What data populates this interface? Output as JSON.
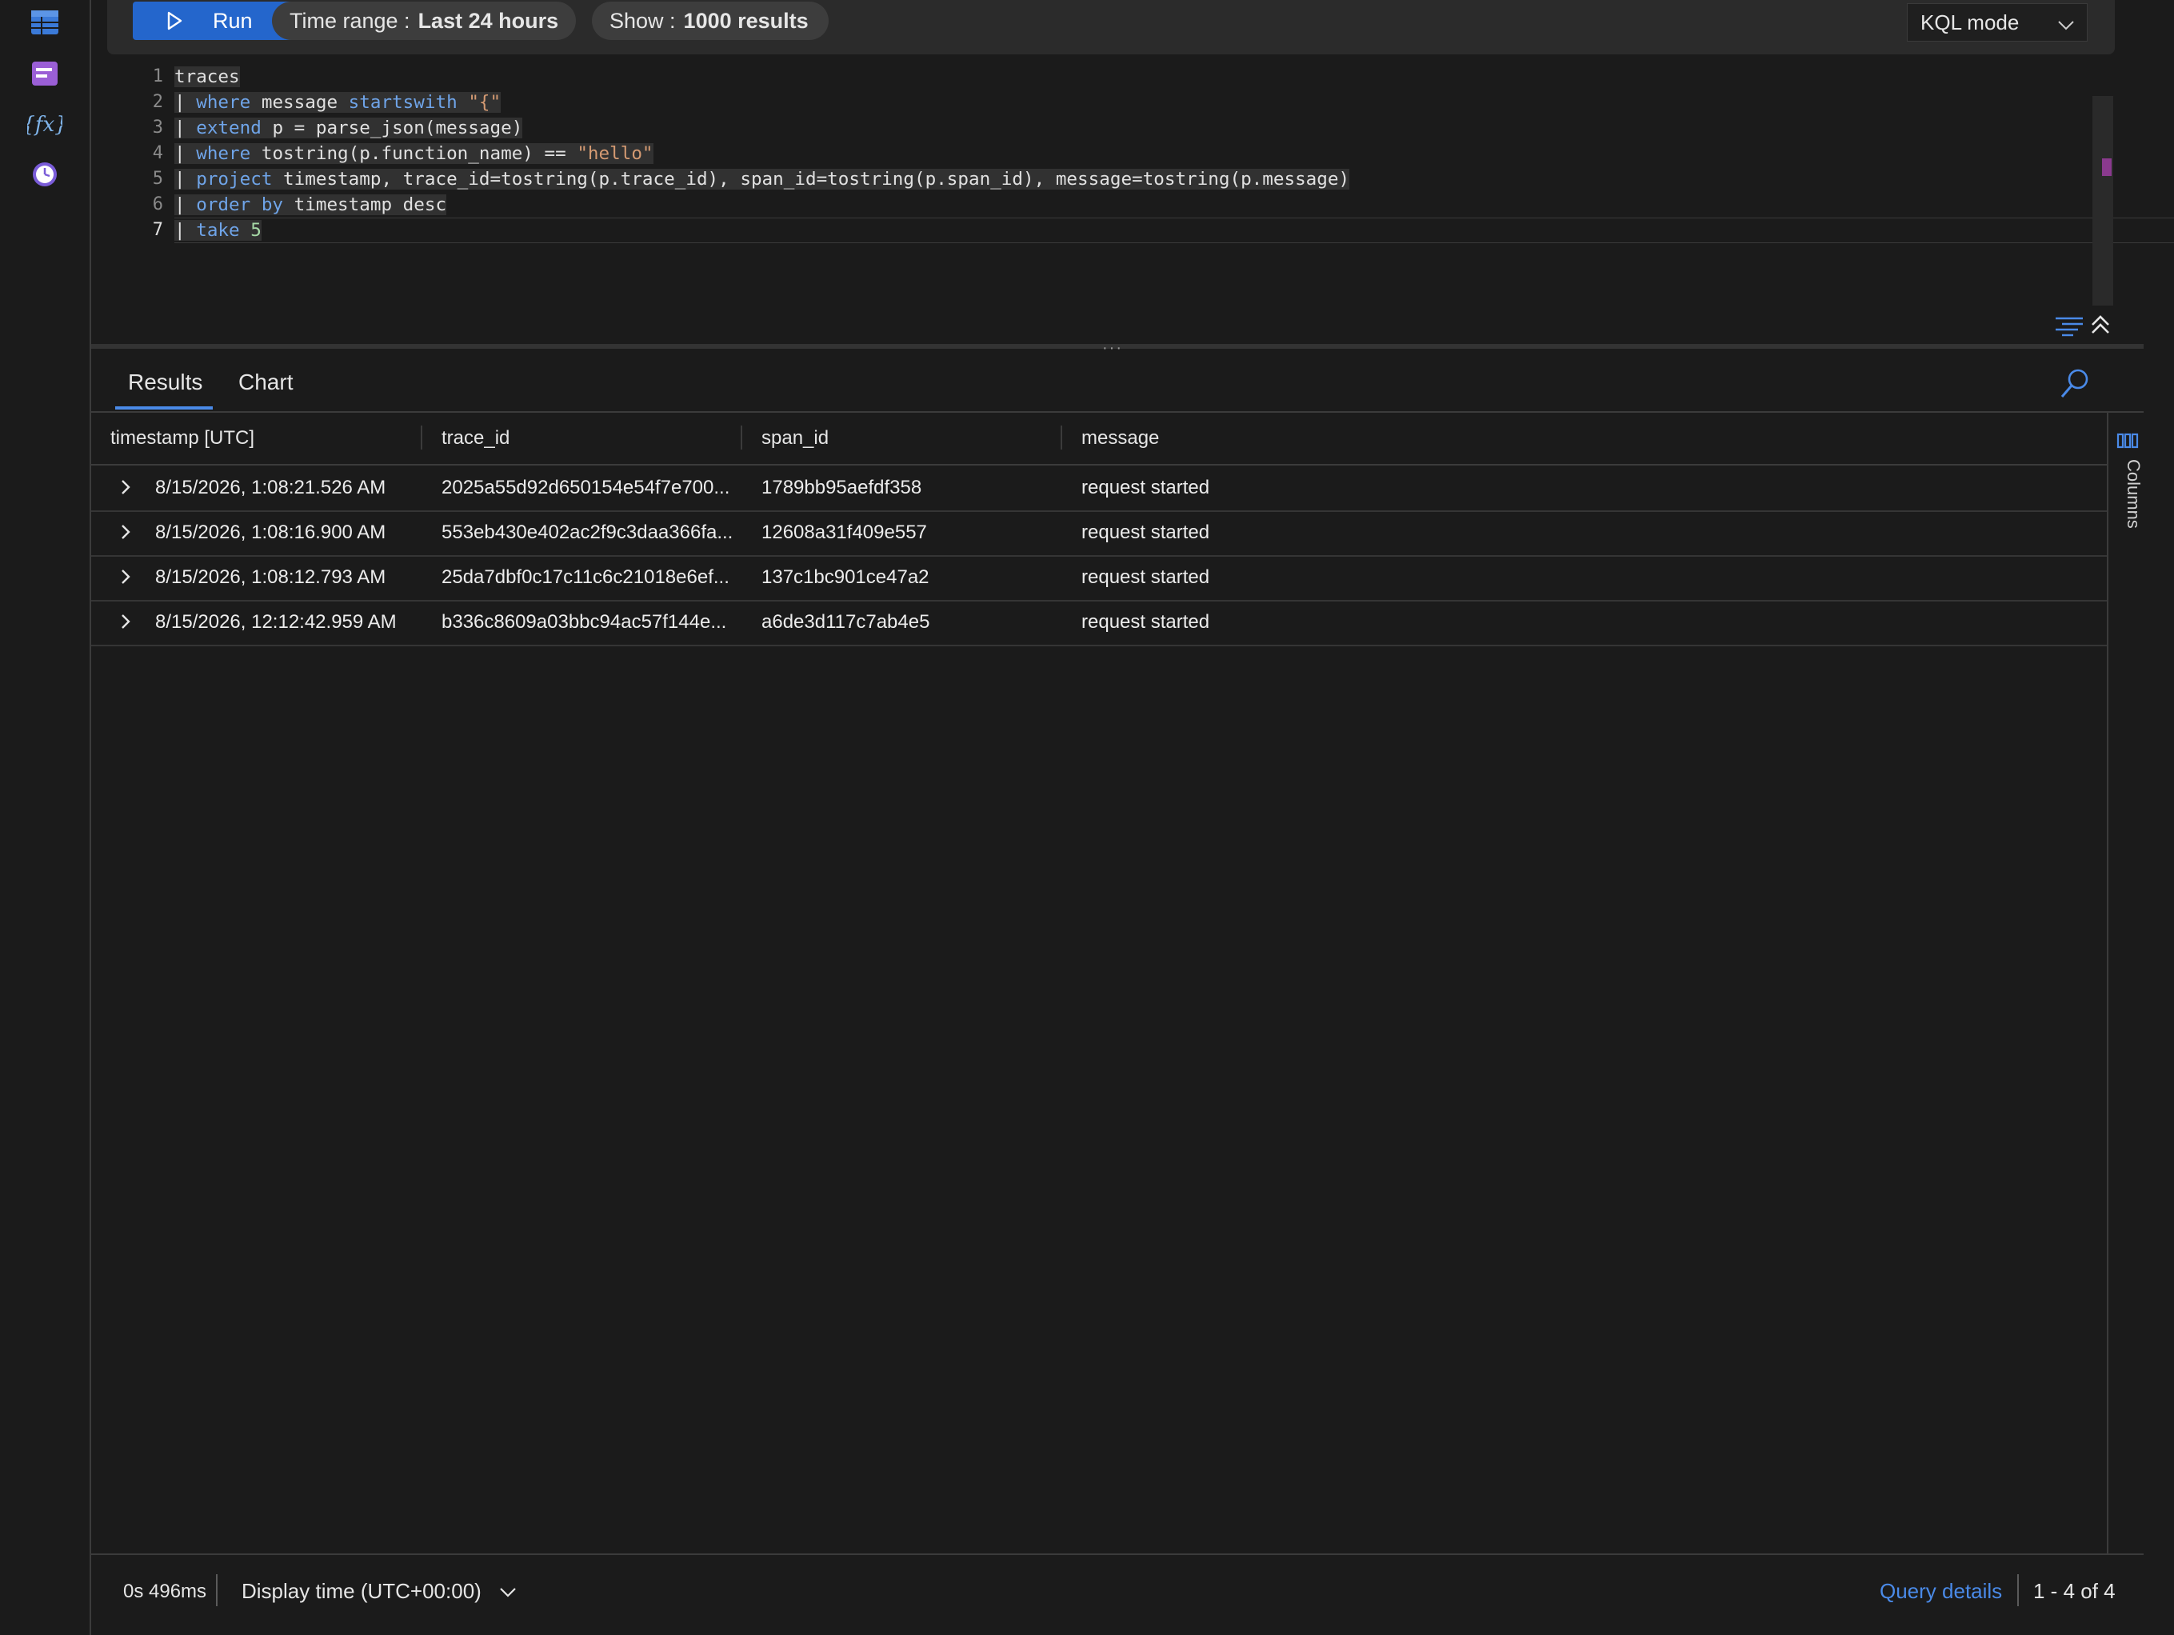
{
  "toolbar": {
    "run_label": "Run",
    "time_range_label": "Time range :",
    "time_range_value": "Last 24 hours",
    "show_label": "Show :",
    "show_value": "1000 results",
    "mode_label": "KQL mode"
  },
  "editor": {
    "line_numbers": [
      "1",
      "2",
      "3",
      "4",
      "5",
      "6",
      "7"
    ],
    "lines": {
      "l1": "traces",
      "l2a": "| ",
      "l2kw": "where",
      "l2b": " message ",
      "l2kw2": "startswith",
      "l2c": " ",
      "l2str": "\"{\"",
      "l3a": "| ",
      "l3kw": "extend",
      "l3b": " p = parse_json(message)",
      "l4a": "| ",
      "l4kw": "where",
      "l4b": " tostring(p.function_name) == ",
      "l4str": "\"hello\"",
      "l5a": "| ",
      "l5kw": "project",
      "l5b": " timestamp, trace_id=tostring(p.trace_id), span_id=tostring(p.span_id), message=tostring(p.message)",
      "l6a": "| ",
      "l6kw": "order by",
      "l6b": " timestamp desc",
      "l7a": "| ",
      "l7kw": "take",
      "l7b": " ",
      "l7num": "5"
    }
  },
  "results": {
    "tabs": [
      "Results",
      "Chart"
    ],
    "columns": [
      "timestamp [UTC]",
      "trace_id",
      "span_id",
      "message"
    ],
    "columns_panel_label": "Columns",
    "rows": [
      {
        "timestamp": "8/15/2026, 1:08:21.526 AM",
        "trace_id": "2025a55d92d650154e54f7e700...",
        "span_id": "1789bb95aefdf358",
        "message": "request started"
      },
      {
        "timestamp": "8/15/2026, 1:08:16.900 AM",
        "trace_id": "553eb430e402ac2f9c3daa366fa...",
        "span_id": "12608a31f409e557",
        "message": "request started"
      },
      {
        "timestamp": "8/15/2026, 1:08:12.793 AM",
        "trace_id": "25da7dbf0c17c11c6c21018e6ef...",
        "span_id": "137c1bc901ce47a2",
        "message": "request started"
      },
      {
        "timestamp": "8/15/2026, 12:12:42.959 AM",
        "trace_id": "b336c8609a03bbc94ac57f144e...",
        "span_id": "a6de3d117c7ab4e5",
        "message": "request started"
      }
    ]
  },
  "footer": {
    "duration": "0s 496ms",
    "display_time": "Display time (UTC+00:00)",
    "query_details": "Query details",
    "count": "1 - 4 of 4"
  },
  "icons": {
    "rail": [
      "tables-icon",
      "queries-icon",
      "functions-icon",
      "history-icon"
    ],
    "accent": "#2466cc",
    "link": "#4a8ae8"
  }
}
